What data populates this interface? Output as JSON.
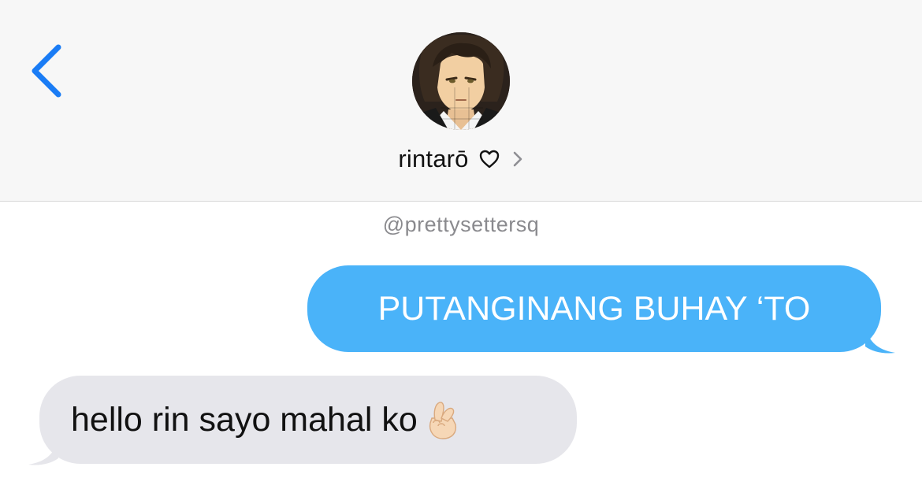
{
  "header": {
    "back_icon": "chevron-left-icon",
    "avatar_icon": "avatar",
    "contact_name": "rintarō",
    "heart_icon": "heart-outline-icon",
    "details_icon": "chevron-right-icon"
  },
  "watermark": "@prettysettersq",
  "messages": [
    {
      "direction": "sent",
      "text": "PUTANGINANG BUHAY ‘TO"
    },
    {
      "direction": "received",
      "text": "hello rin sayo mahal ko",
      "emoji": "crossed-fingers-heart-hand"
    }
  ],
  "colors": {
    "accent": "#1a7cf5",
    "sent_bubble": "#4ab3f9",
    "received_bubble": "#e6e6eb",
    "header_bg": "#f7f7f7",
    "watermark": "#8a8a8e"
  }
}
